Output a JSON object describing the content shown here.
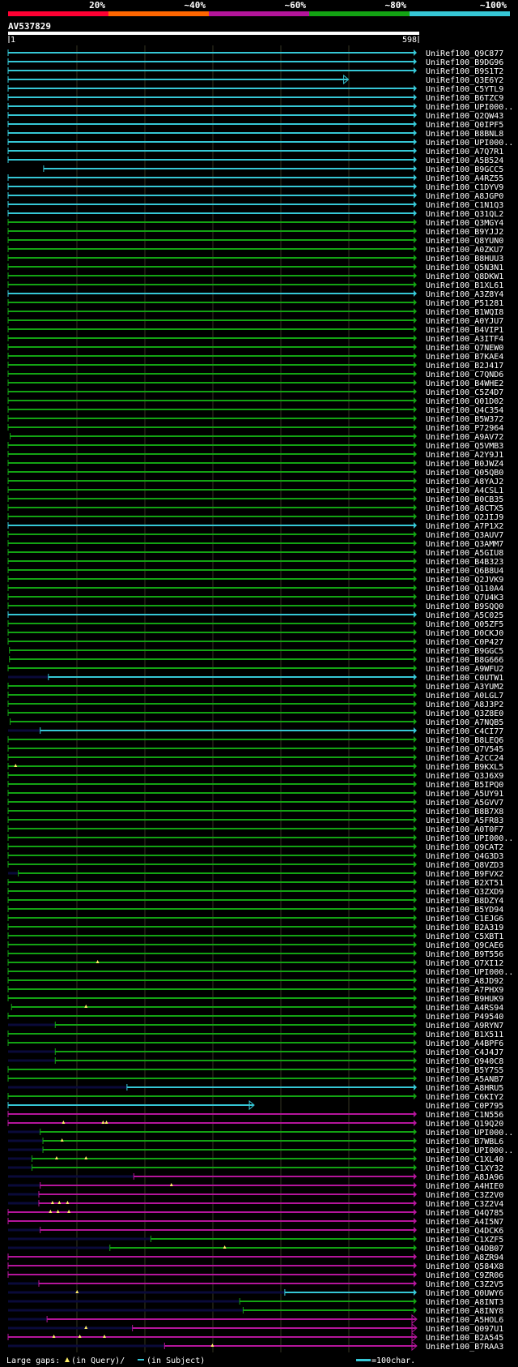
{
  "query": {
    "name": "AV537829",
    "start_label": "1",
    "end_label": "598"
  },
  "identity_scale": [
    {
      "label": "20%",
      "color": "#ff0033"
    },
    {
      "label": "~40%",
      "color": "#ff6600"
    },
    {
      "label": "~60%",
      "color": "#b4159b"
    },
    {
      "label": "~80%",
      "color": "#13a313"
    },
    {
      "label": "~100%",
      "color": "#36c7d6"
    }
  ],
  "colors": {
    "background": "#000000",
    "gridline": "#333322",
    "query_bar": "#ffffff",
    "green": "#13a313",
    "cyan": "#36c7d6",
    "magenta": "#b4159b",
    "navy": "#0a0a3a",
    "gap_marker": "#ffee66"
  },
  "footer": {
    "text_left": "Large gaps:",
    "in_query": "(in Query)/",
    "in_subject": "(in Subject)",
    "scale_label": "=100char."
  },
  "hits": [
    {
      "id": "UniRef100_Q9C877",
      "color": "cyan",
      "start": 1,
      "end": 598
    },
    {
      "id": "UniRef100_B9DG96",
      "color": "cyan",
      "start": 1,
      "end": 598
    },
    {
      "id": "UniRef100_B9S1T2",
      "color": "cyan",
      "start": 1,
      "end": 598
    },
    {
      "id": "UniRef100_Q3E6Y2",
      "color": "cyan",
      "start": 1,
      "end": 498,
      "arrow": true
    },
    {
      "id": "UniRef100_C5YTL9",
      "color": "cyan",
      "start": 1,
      "end": 598
    },
    {
      "id": "UniRef100_B6TZC9",
      "color": "cyan",
      "start": 1,
      "end": 598
    },
    {
      "id": "UniRef100_UPI000..",
      "color": "cyan",
      "start": 1,
      "end": 598
    },
    {
      "id": "UniRef100_Q2QW43",
      "color": "cyan",
      "start": 1,
      "end": 598
    },
    {
      "id": "UniRef100_Q0IPF5",
      "color": "cyan",
      "start": 1,
      "end": 598
    },
    {
      "id": "UniRef100_B8BNL8",
      "color": "cyan",
      "start": 1,
      "end": 598
    },
    {
      "id": "UniRef100_UPI000..",
      "color": "cyan",
      "start": 1,
      "end": 598
    },
    {
      "id": "UniRef100_A7Q7R1",
      "color": "cyan",
      "start": 1,
      "end": 598
    },
    {
      "id": "UniRef100_A5B524",
      "color": "cyan",
      "start": 1,
      "end": 598
    },
    {
      "id": "UniRef100_B9GCC5",
      "color": "cyan",
      "start": 53,
      "end": 598
    },
    {
      "id": "UniRef100_A4RZ55",
      "color": "cyan",
      "start": 1,
      "end": 598
    },
    {
      "id": "UniRef100_C1DYV9",
      "color": "cyan",
      "start": 1,
      "end": 598
    },
    {
      "id": "UniRef100_A8JGP0",
      "color": "cyan",
      "start": 1,
      "end": 598
    },
    {
      "id": "UniRef100_C1N1Q3",
      "color": "cyan",
      "start": 1,
      "end": 598
    },
    {
      "id": "UniRef100_Q31QL2",
      "color": "cyan",
      "start": 1,
      "end": 598
    },
    {
      "id": "UniRef100_Q3MGY4",
      "color": "green",
      "start": 1,
      "end": 598
    },
    {
      "id": "UniRef100_B9YJJ2",
      "color": "green",
      "start": 1,
      "end": 598
    },
    {
      "id": "UniRef100_Q8YUN0",
      "color": "green",
      "start": 1,
      "end": 598
    },
    {
      "id": "UniRef100_A0ZKU7",
      "color": "green",
      "start": 1,
      "end": 598
    },
    {
      "id": "UniRef100_B8HUU3",
      "color": "green",
      "start": 1,
      "end": 598
    },
    {
      "id": "UniRef100_Q5N3N1",
      "color": "green",
      "start": 1,
      "end": 598
    },
    {
      "id": "UniRef100_Q8DKW1",
      "color": "green",
      "start": 1,
      "end": 598
    },
    {
      "id": "UniRef100_B1XL61",
      "color": "green",
      "start": 1,
      "end": 598
    },
    {
      "id": "UniRef100_A3Z8Y4",
      "color": "cyan",
      "start": 1,
      "end": 598
    },
    {
      "id": "UniRef100_P51281",
      "color": "green",
      "start": 1,
      "end": 598
    },
    {
      "id": "UniRef100_B1WQI8",
      "color": "green",
      "start": 1,
      "end": 598
    },
    {
      "id": "UniRef100_A0YJU7",
      "color": "green",
      "start": 1,
      "end": 598
    },
    {
      "id": "UniRef100_B4VIP1",
      "color": "green",
      "start": 1,
      "end": 598
    },
    {
      "id": "UniRef100_A3ITF4",
      "color": "green",
      "start": 1,
      "end": 598
    },
    {
      "id": "UniRef100_Q7NEW0",
      "color": "green",
      "start": 1,
      "end": 598
    },
    {
      "id": "UniRef100_B7KAE4",
      "color": "green",
      "start": 1,
      "end": 598
    },
    {
      "id": "UniRef100_B2J417",
      "color": "green",
      "start": 1,
      "end": 598
    },
    {
      "id": "UniRef100_C7QND6",
      "color": "green",
      "start": 1,
      "end": 598
    },
    {
      "id": "UniRef100_B4WHE2",
      "color": "green",
      "start": 1,
      "end": 598
    },
    {
      "id": "UniRef100_C5Z4D7",
      "color": "green",
      "start": 1,
      "end": 598
    },
    {
      "id": "UniRef100_Q01D02",
      "color": "green",
      "start": 1,
      "end": 598
    },
    {
      "id": "UniRef100_Q4C354",
      "color": "green",
      "start": 1,
      "end": 598
    },
    {
      "id": "UniRef100_B5W372",
      "color": "green",
      "start": 1,
      "end": 598
    },
    {
      "id": "UniRef100_P72964",
      "color": "green",
      "start": 1,
      "end": 598
    },
    {
      "id": "UniRef100_A9AV72",
      "color": "green",
      "start": 4,
      "end": 598
    },
    {
      "id": "UniRef100_Q5VMB3",
      "color": "green",
      "start": 1,
      "end": 598
    },
    {
      "id": "UniRef100_A2Y9J1",
      "color": "green",
      "start": 1,
      "end": 598
    },
    {
      "id": "UniRef100_B0JWZ4",
      "color": "green",
      "start": 1,
      "end": 598
    },
    {
      "id": "UniRef100_Q05QB0",
      "color": "green",
      "start": 1,
      "end": 598
    },
    {
      "id": "UniRef100_A8YAJ2",
      "color": "green",
      "start": 1,
      "end": 598
    },
    {
      "id": "UniRef100_A4CSL1",
      "color": "green",
      "start": 1,
      "end": 598
    },
    {
      "id": "UniRef100_B0CB35",
      "color": "green",
      "start": 1,
      "end": 598
    },
    {
      "id": "UniRef100_A8CTX5",
      "color": "green",
      "start": 1,
      "end": 598
    },
    {
      "id": "UniRef100_Q2JIJ9",
      "color": "green",
      "start": 1,
      "end": 598
    },
    {
      "id": "UniRef100_A7P1X2",
      "color": "cyan",
      "start": 1,
      "end": 598
    },
    {
      "id": "UniRef100_Q3AUV7",
      "color": "green",
      "start": 1,
      "end": 598
    },
    {
      "id": "UniRef100_Q3AMM7",
      "color": "green",
      "start": 1,
      "end": 598
    },
    {
      "id": "UniRef100_A5GIU8",
      "color": "green",
      "start": 1,
      "end": 598
    },
    {
      "id": "UniRef100_B4B323",
      "color": "green",
      "start": 1,
      "end": 598
    },
    {
      "id": "UniRef100_Q6B8U4",
      "color": "green",
      "start": 1,
      "end": 598
    },
    {
      "id": "UniRef100_Q2JVK9",
      "color": "green",
      "start": 1,
      "end": 598
    },
    {
      "id": "UniRef100_Q110A4",
      "color": "green",
      "start": 1,
      "end": 598
    },
    {
      "id": "UniRef100_Q7U4K3",
      "color": "green",
      "start": 1,
      "end": 598
    },
    {
      "id": "UniRef100_B9SQQ0",
      "color": "green",
      "start": 1,
      "end": 598
    },
    {
      "id": "UniRef100_A5C025",
      "color": "cyan",
      "start": 1,
      "end": 598
    },
    {
      "id": "UniRef100_Q05ZF5",
      "color": "green",
      "start": 1,
      "end": 598
    },
    {
      "id": "UniRef100_D0CKJ0",
      "color": "green",
      "start": 1,
      "end": 598
    },
    {
      "id": "UniRef100_C0P427",
      "color": "green",
      "start": 1,
      "end": 598
    },
    {
      "id": "UniRef100_B9GGC5",
      "color": "green",
      "start": 3,
      "end": 598
    },
    {
      "id": "UniRef100_B8G666",
      "color": "green",
      "start": 3,
      "end": 598
    },
    {
      "id": "UniRef100_A9WFU2",
      "color": "green",
      "start": 1,
      "end": 598
    },
    {
      "id": "UniRef100_C0UTW1",
      "color": "cyan",
      "start": 60,
      "end": 598,
      "lead": 60
    },
    {
      "id": "UniRef100_A3YUM2",
      "color": "green",
      "start": 1,
      "end": 598
    },
    {
      "id": "UniRef100_A0LGL7",
      "color": "green",
      "start": 1,
      "end": 598
    },
    {
      "id": "UniRef100_A8J3P2",
      "color": "green",
      "start": 1,
      "end": 598
    },
    {
      "id": "UniRef100_Q3Z8E0",
      "color": "green",
      "start": 1,
      "end": 598
    },
    {
      "id": "UniRef100_A7NQB5",
      "color": "green",
      "start": 4,
      "end": 598
    },
    {
      "id": "UniRef100_C4CI77",
      "color": "cyan",
      "start": 48,
      "end": 598,
      "lead": 48
    },
    {
      "id": "UniRef100_B8LEQ6",
      "color": "green",
      "start": 1,
      "end": 598
    },
    {
      "id": "UniRef100_Q7V545",
      "color": "green",
      "start": 1,
      "end": 598
    },
    {
      "id": "UniRef100_A2CC24",
      "color": "green",
      "start": 1,
      "end": 598
    },
    {
      "id": "UniRef100_B9KXL5",
      "color": "green",
      "start": 1,
      "end": 598,
      "gaps": [
        12
      ]
    },
    {
      "id": "UniRef100_Q3J6X9",
      "color": "green",
      "start": 1,
      "end": 598
    },
    {
      "id": "UniRef100_B5IPQ0",
      "color": "green",
      "start": 1,
      "end": 598
    },
    {
      "id": "UniRef100_A5UY91",
      "color": "green",
      "start": 1,
      "end": 598
    },
    {
      "id": "UniRef100_A5GVV7",
      "color": "green",
      "start": 1,
      "end": 598
    },
    {
      "id": "UniRef100_B8B7X8",
      "color": "green",
      "start": 1,
      "end": 598
    },
    {
      "id": "UniRef100_A5FR83",
      "color": "green",
      "start": 1,
      "end": 598
    },
    {
      "id": "UniRef100_A0T0F7",
      "color": "green",
      "start": 1,
      "end": 598
    },
    {
      "id": "UniRef100_UPI000..",
      "color": "green",
      "start": 1,
      "end": 598
    },
    {
      "id": "UniRef100_Q9CAT2",
      "color": "green",
      "start": 1,
      "end": 598
    },
    {
      "id": "UniRef100_Q4G3D3",
      "color": "green",
      "start": 1,
      "end": 598
    },
    {
      "id": "UniRef100_Q8VZD3",
      "color": "green",
      "start": 1,
      "end": 598
    },
    {
      "id": "UniRef100_B9FVX2",
      "color": "green",
      "start": 16,
      "end": 598,
      "lead": 16
    },
    {
      "id": "UniRef100_B2XT51",
      "color": "green",
      "start": 1,
      "end": 598
    },
    {
      "id": "UniRef100_Q3ZXD9",
      "color": "green",
      "start": 1,
      "end": 598
    },
    {
      "id": "UniRef100_B8DZY4",
      "color": "green",
      "start": 1,
      "end": 598
    },
    {
      "id": "UniRef100_B5YD94",
      "color": "green",
      "start": 1,
      "end": 598
    },
    {
      "id": "UniRef100_C1EJG6",
      "color": "green",
      "start": 1,
      "end": 598
    },
    {
      "id": "UniRef100_B2A319",
      "color": "green",
      "start": 1,
      "end": 598
    },
    {
      "id": "UniRef100_C5XBT1",
      "color": "green",
      "start": 1,
      "end": 598
    },
    {
      "id": "UniRef100_Q9CAE6",
      "color": "green",
      "start": 1,
      "end": 598
    },
    {
      "id": "UniRef100_B9T556",
      "color": "green",
      "start": 1,
      "end": 598
    },
    {
      "id": "UniRef100_Q7XI12",
      "color": "green",
      "start": 1,
      "end": 598,
      "gaps": [
        132
      ]
    },
    {
      "id": "UniRef100_UPI000..",
      "color": "green",
      "start": 1,
      "end": 598
    },
    {
      "id": "UniRef100_A8JD92",
      "color": "green",
      "start": 1,
      "end": 598
    },
    {
      "id": "UniRef100_A7PHX9",
      "color": "green",
      "start": 1,
      "end": 598
    },
    {
      "id": "UniRef100_B9HUK9",
      "color": "green",
      "start": 1,
      "end": 598
    },
    {
      "id": "UniRef100_A4RS94",
      "color": "green",
      "start": 6,
      "end": 598,
      "gaps": [
        115
      ]
    },
    {
      "id": "UniRef100_P49540",
      "color": "green",
      "start": 1,
      "end": 598
    },
    {
      "id": "UniRef100_A9RYN7",
      "color": "green",
      "start": 70,
      "end": 598,
      "lead": 70
    },
    {
      "id": "UniRef100_B1X511",
      "color": "green",
      "start": 1,
      "end": 598
    },
    {
      "id": "UniRef100_A4BPF6",
      "color": "green",
      "start": 1,
      "end": 598
    },
    {
      "id": "UniRef100_C4J4J7",
      "color": "green",
      "start": 70,
      "end": 598,
      "lead": 70
    },
    {
      "id": "UniRef100_Q940C8",
      "color": "green",
      "start": 70,
      "end": 598,
      "lead": 70
    },
    {
      "id": "UniRef100_B5Y7S5",
      "color": "green",
      "start": 1,
      "end": 598
    },
    {
      "id": "UniRef100_A5ANB7",
      "color": "green",
      "start": 1,
      "end": 598
    },
    {
      "id": "UniRef100_A8HRU5",
      "color": "cyan",
      "start": 175,
      "end": 598,
      "lead": 175
    },
    {
      "id": "UniRef100_C6KIY2",
      "color": "green",
      "start": 1,
      "end": 598
    },
    {
      "id": "UniRef100_C0P795",
      "color": "cyan",
      "start": 1,
      "end": 360,
      "arrow": true
    },
    {
      "id": "UniRef100_C1N556",
      "color": "magenta",
      "start": 1,
      "end": 598
    },
    {
      "id": "UniRef100_Q19Q20",
      "color": "magenta",
      "start": 1,
      "end": 598,
      "gaps": [
        82,
        140,
        145
      ]
    },
    {
      "id": "UniRef100_UPI000..",
      "color": "green",
      "start": 48,
      "end": 598,
      "lead": 48
    },
    {
      "id": "UniRef100_B7WBL6",
      "color": "green",
      "start": 52,
      "end": 598,
      "lead": 52,
      "gaps": [
        80
      ]
    },
    {
      "id": "UniRef100_UPI000..",
      "color": "green",
      "start": 52,
      "end": 598,
      "lead": 52
    },
    {
      "id": "UniRef100_C1XL40",
      "color": "green",
      "start": 36,
      "end": 598,
      "lead": 36,
      "gaps": [
        72,
        115
      ]
    },
    {
      "id": "UniRef100_C1XY32",
      "color": "green",
      "start": 36,
      "end": 598,
      "lead": 36
    },
    {
      "id": "UniRef100_A8JA96",
      "color": "magenta",
      "start": 185,
      "end": 598,
      "lead": 185
    },
    {
      "id": "UniRef100_A4HIE0",
      "color": "magenta",
      "start": 48,
      "end": 598,
      "lead": 48,
      "gaps": [
        240
      ]
    },
    {
      "id": "UniRef100_C3Z2V0",
      "color": "magenta",
      "start": 46,
      "end": 598,
      "lead": 46
    },
    {
      "id": "UniRef100_C3Z2V4",
      "color": "magenta",
      "start": 46,
      "end": 598,
      "lead": 46,
      "gaps": [
        66,
        76,
        88
      ]
    },
    {
      "id": "UniRef100_Q4Q785",
      "color": "magenta",
      "start": 1,
      "end": 598,
      "gaps": [
        63,
        74,
        90
      ]
    },
    {
      "id": "UniRef100_A4I5N7",
      "color": "magenta",
      "start": 1,
      "end": 598
    },
    {
      "id": "UniRef100_Q4DCK6",
      "color": "magenta",
      "start": 48,
      "end": 598,
      "lead": 48
    },
    {
      "id": "UniRef100_C1XZF5",
      "color": "green",
      "start": 210,
      "end": 598,
      "lead": 210
    },
    {
      "id": "UniRef100_Q4DB07",
      "color": "green",
      "start": 150,
      "end": 598,
      "lead": 150,
      "gaps": [
        318
      ]
    },
    {
      "id": "UniRef100_A8ZR94",
      "color": "magenta",
      "start": 1,
      "end": 598
    },
    {
      "id": "UniRef100_Q584X8",
      "color": "magenta",
      "start": 1,
      "end": 598
    },
    {
      "id": "UniRef100_C9ZR06",
      "color": "magenta",
      "start": 1,
      "end": 598
    },
    {
      "id": "UniRef100_C3Z2V5",
      "color": "magenta",
      "start": 46,
      "end": 598,
      "lead": 46
    },
    {
      "id": "UniRef100_Q0UWY6",
      "color": "cyan",
      "start": 406,
      "end": 598,
      "lead": 406,
      "gaps": [
        102
      ]
    },
    {
      "id": "UniRef100_A8INT3",
      "color": "green",
      "start": 340,
      "end": 598,
      "lead": 340
    },
    {
      "id": "UniRef100_A8INY8",
      "color": "green",
      "start": 345,
      "end": 598,
      "lead": 345
    },
    {
      "id": "UniRef100_A5HOL6",
      "color": "magenta",
      "start": 58,
      "end": 598,
      "lead": 58,
      "arrow": true
    },
    {
      "id": "UniRef100_Q097U1",
      "color": "magenta",
      "start": 183,
      "end": 598,
      "lead": 183,
      "arrow": true,
      "gaps": [
        115
      ]
    },
    {
      "id": "UniRef100_B2A545",
      "color": "magenta",
      "start": 1,
      "end": 598,
      "arrow": true,
      "gaps": [
        68,
        106,
        142
      ]
    },
    {
      "id": "UniRef100_B7RAA3",
      "color": "magenta",
      "start": 230,
      "end": 598,
      "lead": 230,
      "arrow": true,
      "gaps": [
        300
      ]
    }
  ]
}
